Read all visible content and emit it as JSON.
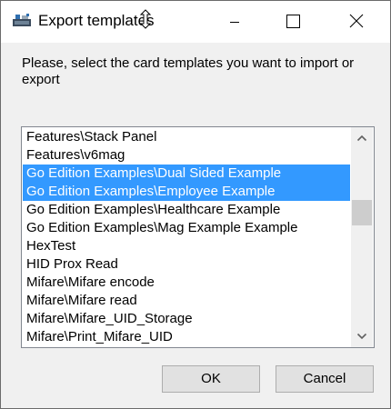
{
  "window": {
    "title": "Export templates"
  },
  "prompt": {
    "text": "Please, select the card templates you want to import or export"
  },
  "templates_list": {
    "items": [
      {
        "label": "Features\\Stack Panel",
        "selected": false
      },
      {
        "label": "Features\\v6mag",
        "selected": false
      },
      {
        "label": "Go Edition Examples\\Dual Sided Example",
        "selected": true
      },
      {
        "label": "Go Edition Examples\\Employee Example",
        "selected": true
      },
      {
        "label": "Go Edition Examples\\Healthcare Example",
        "selected": false
      },
      {
        "label": "Go Edition Examples\\Mag Example Example",
        "selected": false
      },
      {
        "label": "HexTest",
        "selected": false
      },
      {
        "label": "HID Prox Read",
        "selected": false
      },
      {
        "label": "Mifare\\Mifare encode",
        "selected": false
      },
      {
        "label": "Mifare\\Mifare read",
        "selected": false
      },
      {
        "label": "Mifare\\Mifare_UID_Storage",
        "selected": false
      },
      {
        "label": "Mifare\\Print_Mifare_UID",
        "selected": false
      }
    ]
  },
  "buttons": {
    "ok_label": "OK",
    "cancel_label": "Cancel"
  },
  "colors": {
    "selection": "#3399ff",
    "selection_text": "#ffffff",
    "dialog_background": "#f0f0f0"
  },
  "icons": {
    "app": "app-card-printer-icon",
    "cursor": "resize-cursor-icon",
    "minimize": "minimize-icon",
    "maximize": "maximize-icon",
    "close": "close-icon",
    "scroll_up": "chevron-up-icon",
    "scroll_down": "chevron-down-icon"
  }
}
